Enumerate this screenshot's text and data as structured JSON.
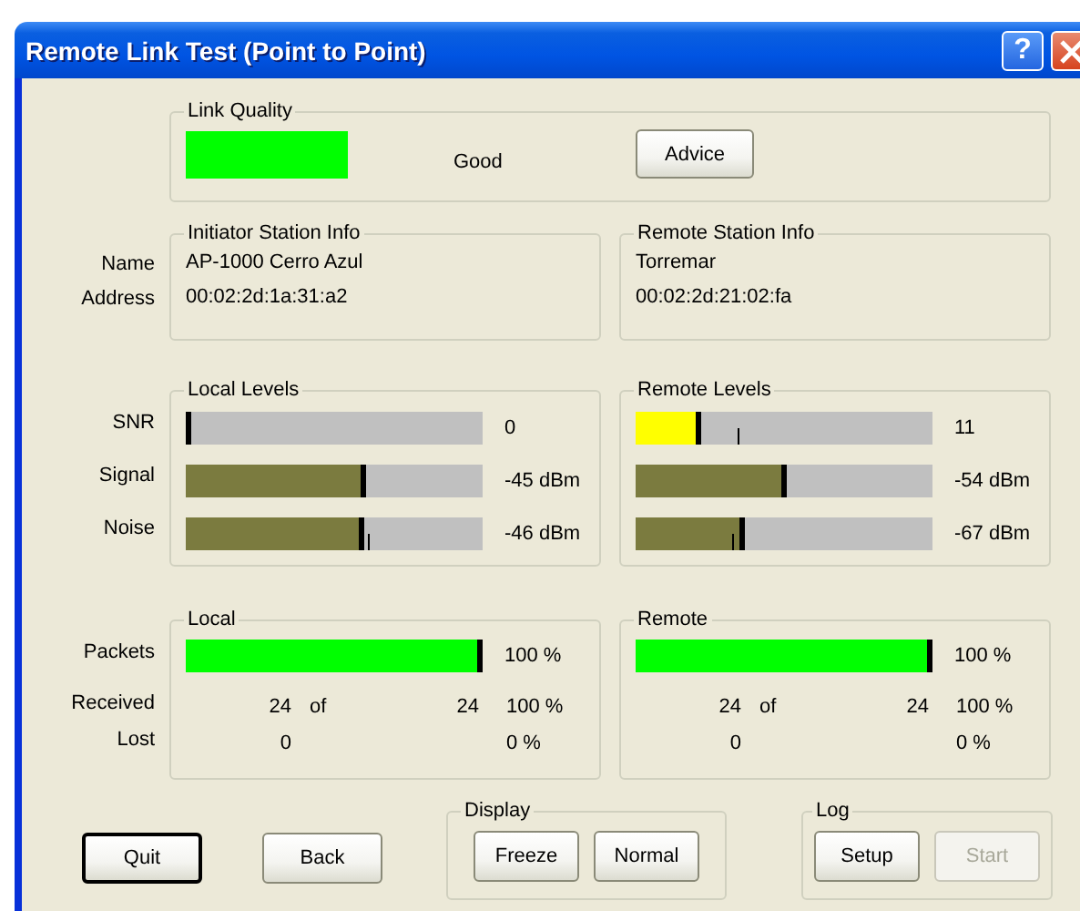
{
  "window": {
    "title": "Remote Link Test (Point to Point)",
    "help_button": "?"
  },
  "link_quality": {
    "title": "Link Quality",
    "color": "#00ff00",
    "status": "Good",
    "button": "Advice"
  },
  "station_labels": [
    "Name",
    "Address"
  ],
  "stations": [
    {
      "title": "Initiator Station Info",
      "name": "AP-1000 Cerro Azul",
      "address": "00:02:2d:1a:31:a2"
    },
    {
      "title": "Remote Station Info",
      "name": "Torremar",
      "address": "00:02:2d:21:02:fa"
    }
  ],
  "level_labels": [
    "SNR",
    "Signal",
    "Noise"
  ],
  "levels": [
    {
      "title": "Local Levels",
      "meters": [
        {
          "level": 0,
          "reading": "0"
        },
        {
          "level": 0.61,
          "color": "#7b7b3f",
          "reading": "-45 dBm"
        },
        {
          "level": 0.6,
          "color": "#7b7b3f",
          "tick": {
            "level": 0.615
          },
          "reading": "-46 dBm"
        }
      ]
    },
    {
      "title": "Remote Levels",
      "meters": [
        {
          "level": 0.22,
          "color": "#ffff00",
          "tick": {
            "level": 0.345
          },
          "reading": "11"
        },
        {
          "level": 0.51,
          "color": "#7b7b3f",
          "reading": "-54 dBm"
        },
        {
          "level": 0.37,
          "color": "#7b7b3f",
          "tick": {
            "level": 0.325
          },
          "reading": "-67 dBm"
        }
      ]
    }
  ],
  "packet_labels": [
    "Packets",
    "Received",
    "Lost"
  ],
  "packets": [
    {
      "title": "Local",
      "level": 1,
      "color": "#00ff00",
      "percent": "100 %",
      "received": "24",
      "of": "of",
      "total": "24",
      "received_percent": "100 %",
      "lost": "0",
      "lost_percent": "0 %"
    },
    {
      "title": "Remote",
      "level": 1,
      "color": "#00ff00",
      "percent": "100 %",
      "received": "24",
      "of": "of",
      "total": "24",
      "received_percent": "100 %",
      "lost": "0",
      "lost_percent": "0 %"
    }
  ],
  "buttons": [
    {
      "label": "Quit",
      "default": true
    },
    {
      "label": "Back",
      "default": false
    }
  ],
  "display": {
    "title": "Display",
    "buttons": [
      {
        "label": "Freeze",
        "disabled": false
      },
      {
        "label": "Normal",
        "disabled": false
      }
    ]
  },
  "log": {
    "title": "Log",
    "buttons": [
      {
        "label": "Setup",
        "disabled": false
      },
      {
        "label": "Start",
        "disabled": true
      }
    ]
  }
}
